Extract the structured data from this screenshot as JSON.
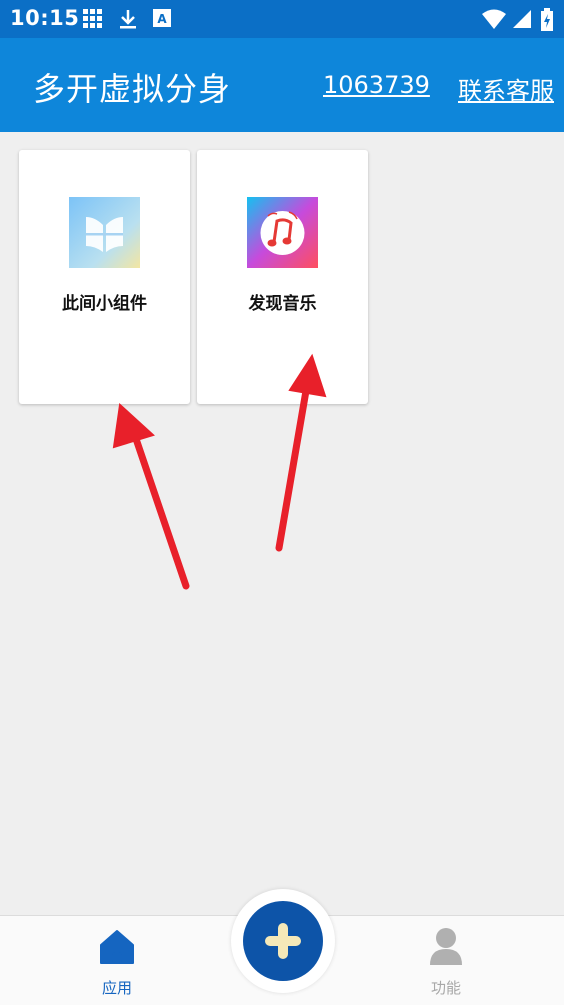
{
  "status_bar": {
    "time": "10:15",
    "icons": [
      "grid-icon",
      "download-icon",
      "font-icon",
      "wifi-icon",
      "signal-icon",
      "battery-icon"
    ]
  },
  "header": {
    "title": "多开虚拟分身",
    "id_number": "1063739",
    "contact_label": "联系客服"
  },
  "apps": [
    {
      "label": "此间小组件",
      "icon": "widget-book-icon"
    },
    {
      "label": "发现音乐",
      "icon": "music-note-icon"
    }
  ],
  "bottom_nav": {
    "items": [
      {
        "label": "应用",
        "icon": "home-icon",
        "active": true
      },
      {
        "label": "功能",
        "icon": "person-icon",
        "active": false
      }
    ],
    "fab_icon": "plus-icon"
  },
  "colors": {
    "status_bar": "#0b6fc6",
    "app_bar": "#0e86da",
    "active_nav": "#1565c0",
    "inactive_nav": "#a8a8a8",
    "fab": "#0d54a8",
    "annotation_arrow": "#e8202a"
  }
}
